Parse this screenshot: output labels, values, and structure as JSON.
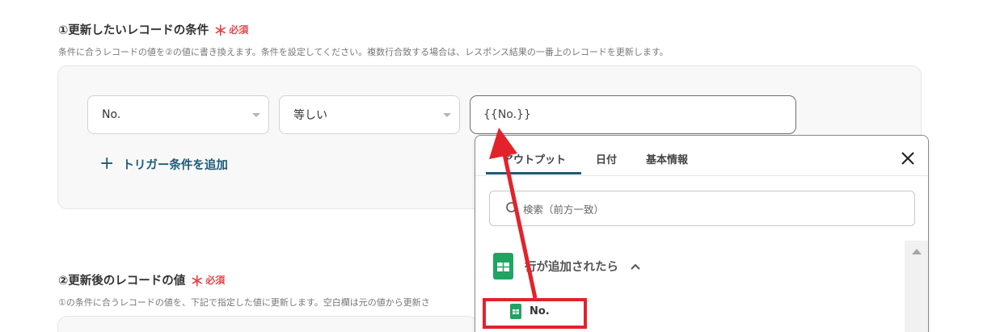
{
  "section1": {
    "title": "①更新したいレコードの条件",
    "required_mark": "＊",
    "required_label": "必須",
    "description": "条件に合うレコードの値を②の値に書き換えます。条件を設定してください。複数行合致する場合は、レスポンス結果の一番上のレコードを更新します。"
  },
  "condition": {
    "field_value": "No.",
    "operator_value": "等しい",
    "value": "{{No.}}",
    "add_trigger_label": "トリガー条件を追加"
  },
  "section2": {
    "title": "②更新後のレコードの値",
    "required_mark": "＊",
    "required_label": "必須",
    "description": "①の条件に合うレコードの値を、下記で指定した値に更新します。空白欄は元の値から更新さ"
  },
  "dropdown": {
    "tabs": [
      "アウトプット",
      "日付",
      "基本情報"
    ],
    "active_tab": "アウトプット",
    "search_placeholder": "検索（前方一致）",
    "group_label": "行が追加されたら",
    "item_label": "No."
  },
  "icons": {
    "close": "close-icon",
    "search": "search-icon",
    "sheet": "sheets-icon",
    "chevron": "chevron-up-icon",
    "caret": "caret-down-icon"
  },
  "colors": {
    "accent": "#1e5a78",
    "required": "#e8464e",
    "annotation": "#e3222b",
    "sheets_green": "#1fa463"
  }
}
